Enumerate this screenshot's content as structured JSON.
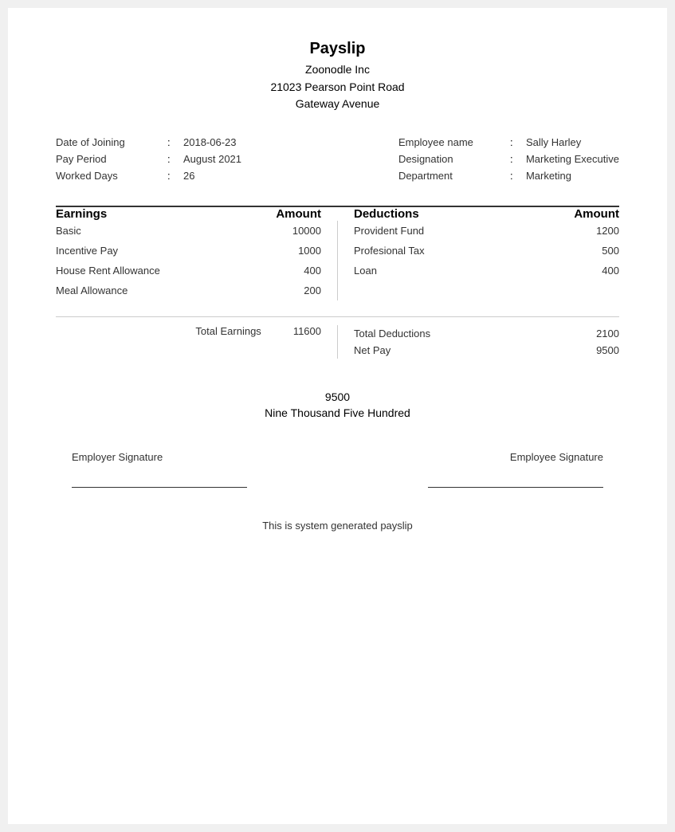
{
  "header": {
    "title": "Payslip",
    "company": "Zoonodle Inc",
    "address_line1": "21023 Pearson Point Road",
    "address_line2": "Gateway Avenue"
  },
  "employee": {
    "date_of_joining_label": "Date of Joining",
    "date_of_joining_value": "2018-06-23",
    "pay_period_label": "Pay Period",
    "pay_period_value": "August 2021",
    "worked_days_label": "Worked Days",
    "worked_days_value": "26",
    "employee_name_label": "Employee name",
    "employee_name_value": "Sally Harley",
    "designation_label": "Designation",
    "designation_value": "Marketing Executive",
    "department_label": "Department",
    "department_value": "Marketing"
  },
  "earnings": {
    "header_label": "Earnings",
    "header_amount": "Amount",
    "items": [
      {
        "label": "Basic",
        "amount": "10000"
      },
      {
        "label": "Incentive Pay",
        "amount": "1000"
      },
      {
        "label": "House Rent Allowance",
        "amount": "400"
      },
      {
        "label": "Meal Allowance",
        "amount": "200"
      }
    ],
    "total_label": "Total Earnings",
    "total_amount": "11600"
  },
  "deductions": {
    "header_label": "Deductions",
    "header_amount": "Amount",
    "items": [
      {
        "label": "Provident Fund",
        "amount": "1200"
      },
      {
        "label": "Profesional Tax",
        "amount": "500"
      },
      {
        "label": "Loan",
        "amount": "400"
      }
    ],
    "total_label": "Total Deductions",
    "total_amount": "2100",
    "net_pay_label": "Net Pay",
    "net_pay_amount": "9500"
  },
  "net_pay": {
    "number": "9500",
    "words": "Nine Thousand Five Hundred"
  },
  "signatures": {
    "employer_label": "Employer Signature",
    "employee_label": "Employee Signature"
  },
  "footer": {
    "text": "This is system generated payslip"
  }
}
